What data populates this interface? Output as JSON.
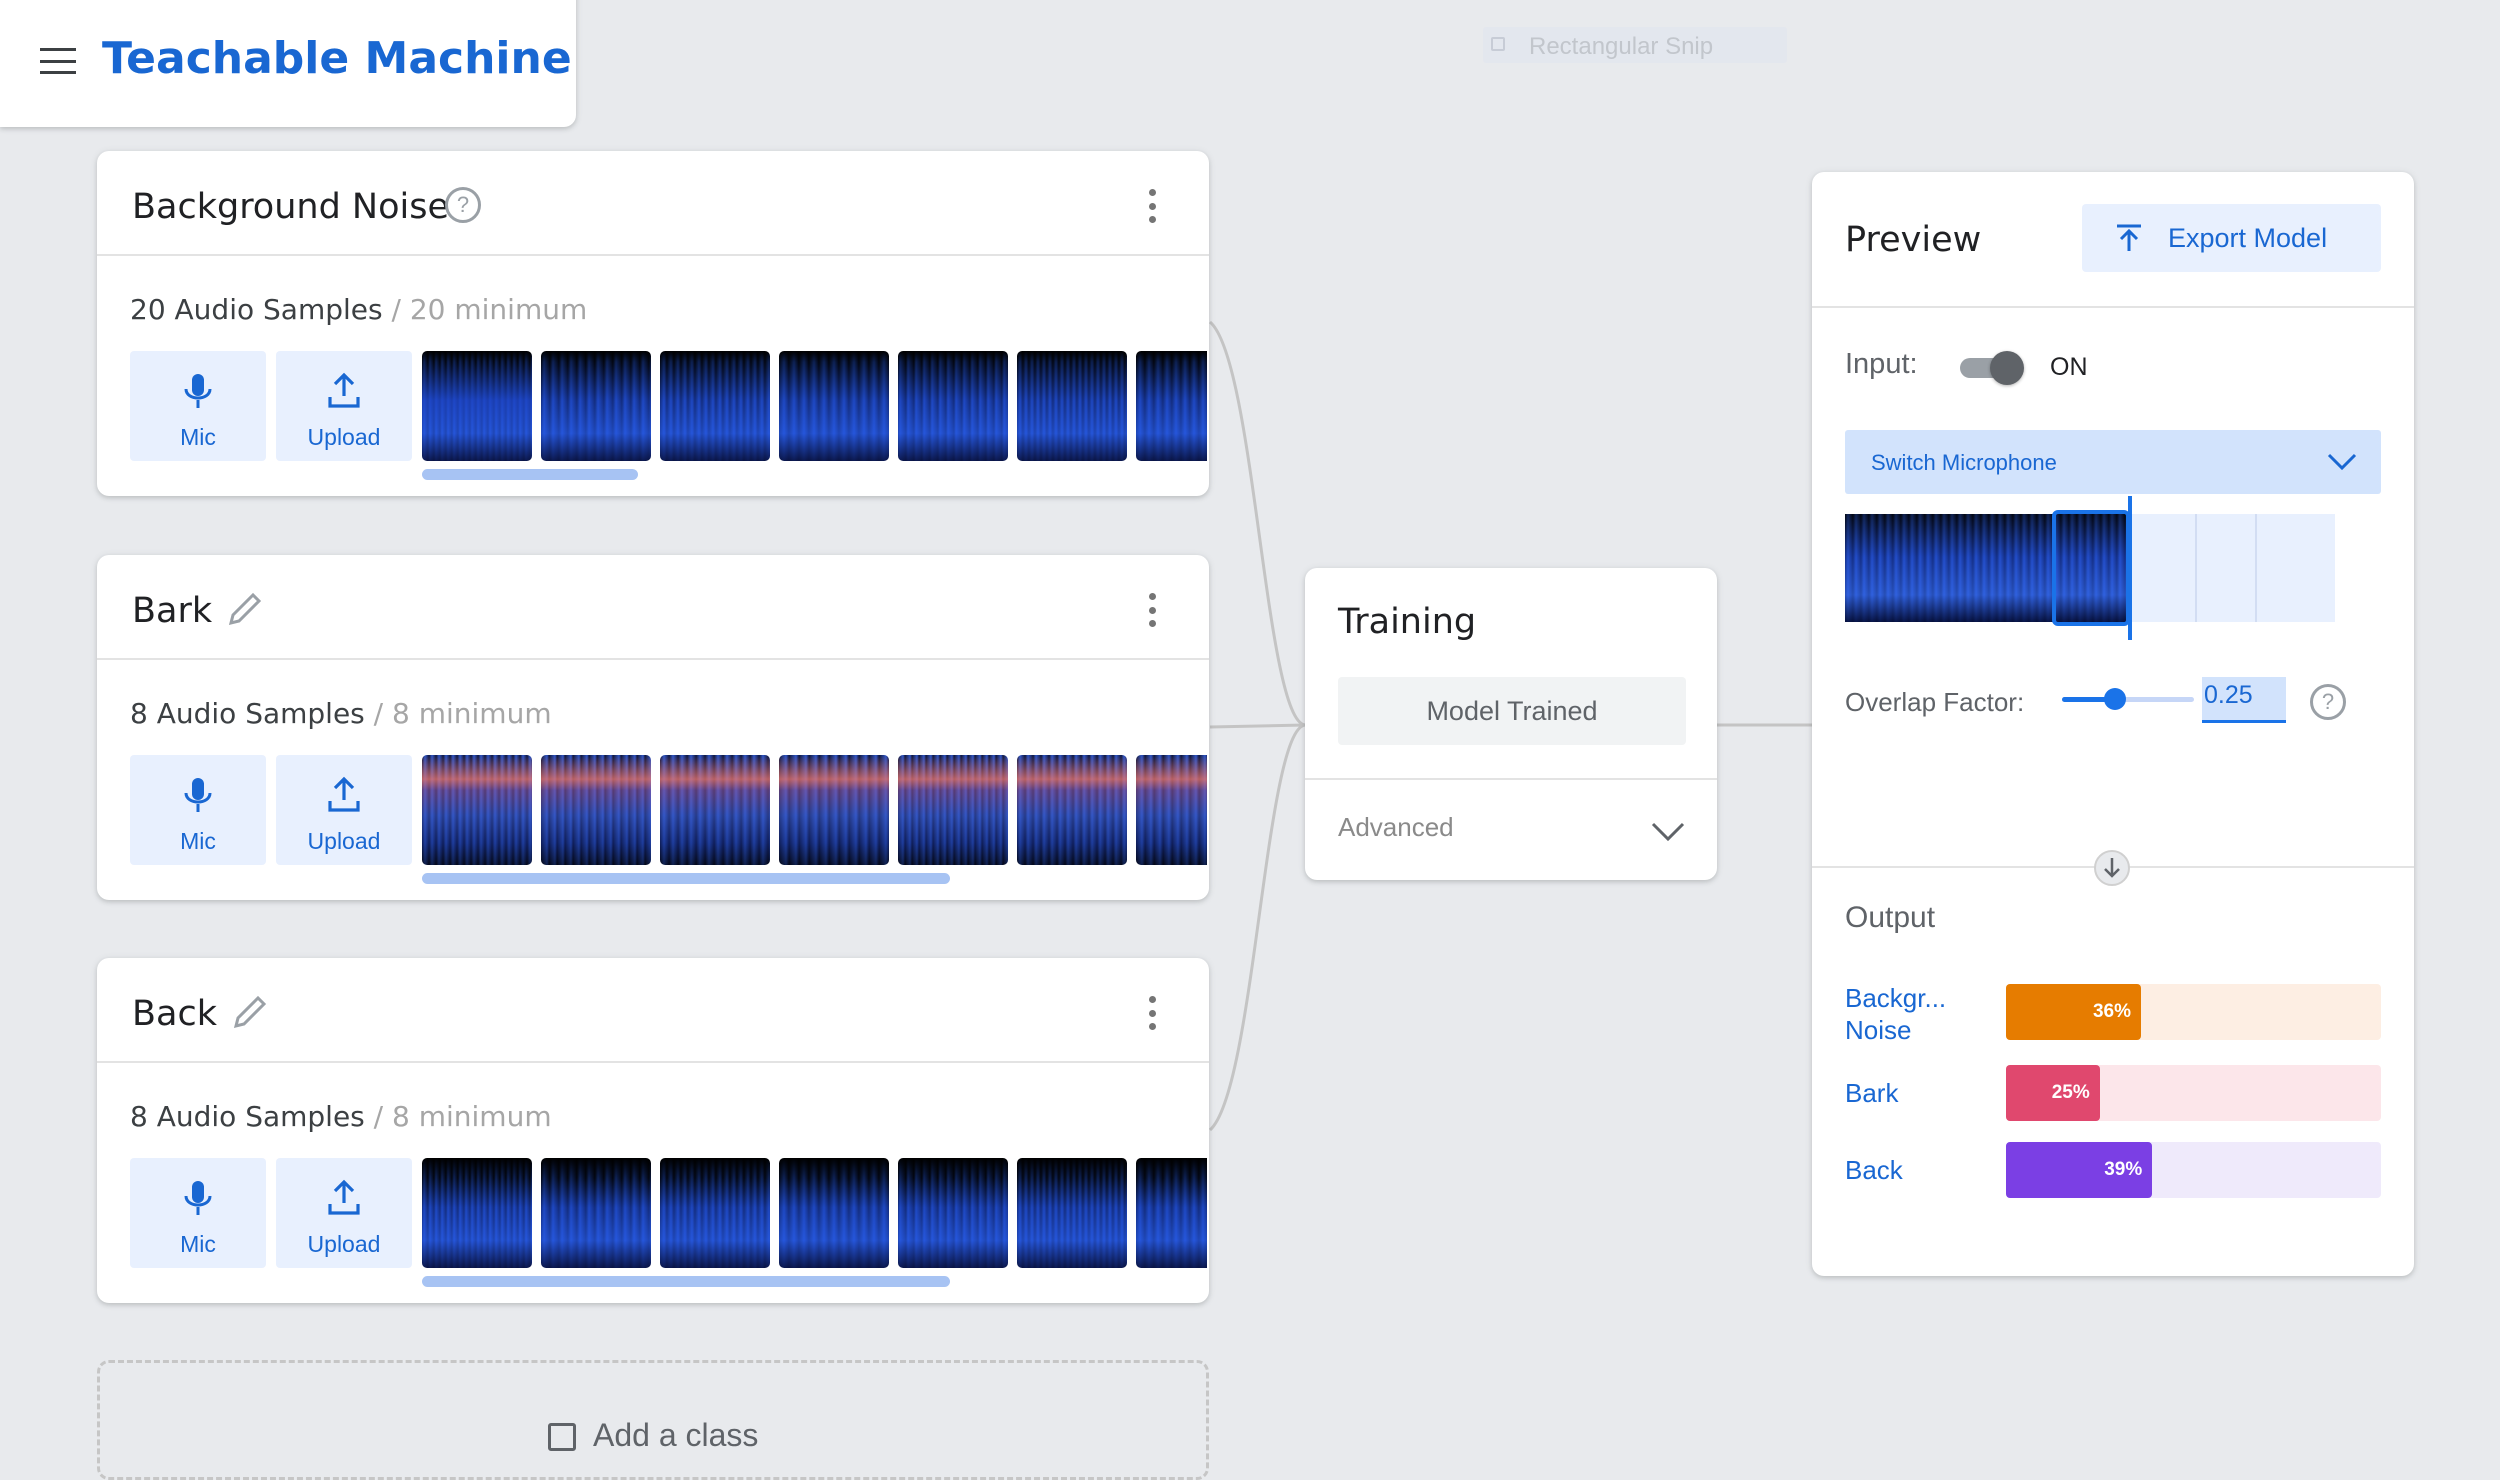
{
  "app": {
    "title": "Teachable Machine"
  },
  "snip_label": "Rectangular Snip",
  "classes": [
    {
      "name": "Background Noise",
      "count_text": "20 Audio Samples",
      "minimum_text": " / 20 minimum",
      "progress": 0.27,
      "thumb_style": "noise"
    },
    {
      "name": "Bark",
      "count_text": "8 Audio Samples",
      "minimum_text": " / 8 minimum",
      "progress": 0.66,
      "thumb_style": "bark"
    },
    {
      "name": "Back",
      "count_text": "8 Audio Samples",
      "minimum_text": " / 8 minimum",
      "progress": 0.66,
      "thumb_style": "back"
    }
  ],
  "buttons": {
    "mic_label": "Mic",
    "upload_label": "Upload"
  },
  "add_class": {
    "label": "Add a class"
  },
  "training": {
    "title": "Training",
    "button_label": "Model Trained",
    "advanced_label": "Advanced"
  },
  "preview": {
    "title": "Preview",
    "export_label": "Export Model",
    "input_label": "Input:",
    "toggle_state": "ON",
    "switch_mic_label": "Switch Microphone",
    "overlap_label": "Overlap Factor:",
    "overlap_value": "0.25",
    "overlap_fraction": 0.4,
    "output_title": "Output",
    "outputs": [
      {
        "label": "Backgr... Noise",
        "percent": 36,
        "percent_text": "36%",
        "color": "#e67c00",
        "track": "#fdeee3"
      },
      {
        "label": "Bark",
        "percent": 25,
        "percent_text": "25%",
        "color": "#e0486e",
        "track": "#fce6ea"
      },
      {
        "label": "Back",
        "percent": 39,
        "percent_text": "39%",
        "color": "#7b3fe4",
        "track": "#efeafb"
      }
    ]
  },
  "colors": {
    "accent": "#1967d2",
    "tile_bg": "#e8f0fe"
  }
}
